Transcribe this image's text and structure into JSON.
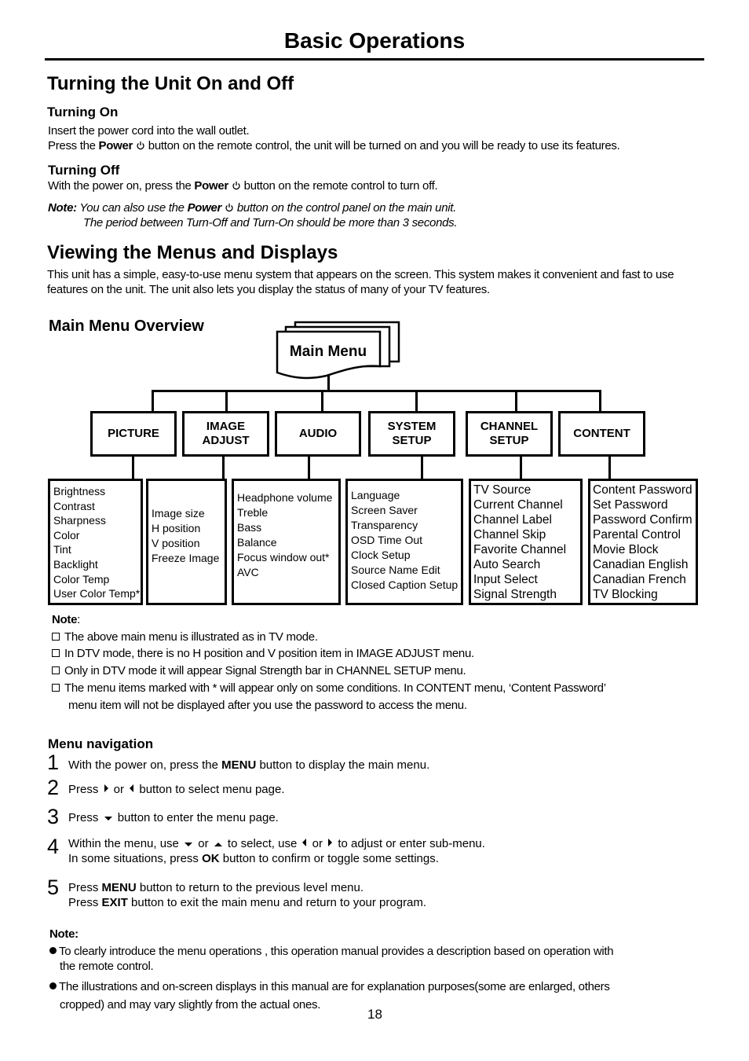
{
  "page": {
    "title": "Basic Operations",
    "page_number": "18"
  },
  "turning": {
    "heading": "Turning the Unit On and Off",
    "on": {
      "heading": "Turning On",
      "line1": "Insert the power cord into the wall outlet.",
      "line2_pre": "Press the ",
      "line2_bold": "Power",
      "line2_post": " button on the remote control, the unit will be turned on and you will be ready to use its features."
    },
    "off": {
      "heading": "Turning Off",
      "line_pre": "With the power on, press the ",
      "line_bold": "Power",
      "line_post": " button on the remote control to turn off."
    },
    "note": {
      "label": "Note:",
      "line1_pre": " You can also use the ",
      "line1_bold": "Power",
      "line1_post": " button on the control panel on the main unit.",
      "line2": "The period between Turn-Off and Turn-On should be more than 3 seconds."
    }
  },
  "menus": {
    "heading": "Viewing the Menus and Displays",
    "intro": "This unit has a simple, easy-to-use menu system that appears on the screen. This system makes it convenient and fast to use features on the unit. The unit also lets you display the status of many of your TV features.",
    "overview_heading": "Main Menu Overview",
    "main_menu_label": "Main Menu",
    "categories": [
      {
        "label": "PICTURE",
        "items": [
          "Brightness",
          "Contrast",
          "Sharpness",
          "Color",
          "Tint",
          "Backlight",
          "Color Temp",
          "User Color Temp*"
        ]
      },
      {
        "label": "IMAGE ADJUST",
        "items": [
          "Image size",
          "H position",
          "V position",
          "Freeze Image"
        ]
      },
      {
        "label": "AUDIO",
        "items": [
          "Headphone volume",
          "Treble",
          "Bass",
          "Balance",
          "Focus window out*",
          "AVC"
        ]
      },
      {
        "label": "SYSTEM SETUP",
        "items": [
          "Language",
          "Screen Saver",
          "Transparency",
          "OSD Time Out",
          "Clock Setup",
          "Source Name Edit",
          "Closed Caption Setup"
        ]
      },
      {
        "label": "CHANNEL SETUP",
        "items": [
          "TV Source",
          "Current Channel",
          "Channel Label",
          "Channel Skip",
          "Favorite Channel",
          "Auto Search",
          "Input Select",
          "Signal Strength"
        ]
      },
      {
        "label": "CONTENT",
        "items": [
          "Content Password",
          "Set Password",
          "Password Confirm",
          "Parental Control",
          "Movie Block",
          "Canadian English",
          "Canadian French",
          "TV Blocking"
        ]
      }
    ]
  },
  "menu_notes": {
    "label": "Note",
    "items": [
      "The above main menu is illustrated as in TV mode.",
      "In DTV mode, there is no H position and V position item in IMAGE ADJUST menu.",
      "Only in DTV mode it will appear Signal Strength bar in CHANNEL SETUP menu.",
      "The menu items marked with * will appear only on some conditions. In CONTENT menu, ‘Content Password’",
      "menu item will not be displayed after you use the password to access the menu."
    ]
  },
  "navigation": {
    "heading": "Menu navigation",
    "steps": [
      {
        "num": "1",
        "pre": "With the power on, press the ",
        "bold": "MENU",
        "post": " button to display the main menu."
      },
      {
        "num": "2",
        "pre": "Press ",
        "mid": " or ",
        "post": " button to select menu page."
      },
      {
        "num": "3",
        "pre": "Press ",
        "post": " button to enter the menu page."
      },
      {
        "num": "4",
        "pre": "Within the menu, use ",
        "or1": " or ",
        "mid": " to select, use ",
        "or2": " or ",
        "post": " to adjust or enter sub-menu.",
        "line2_pre": "In some situations, press ",
        "line2_bold": "OK",
        "line2_post": " button to confirm or toggle some settings."
      },
      {
        "num": "5",
        "pre": "Press ",
        "bold": "MENU",
        "post": " button to return to the previous level menu.",
        "line2_pre": "Press ",
        "line2_bold": "EXIT",
        "line2_post": " button to exit the main menu and return to your program."
      }
    ]
  },
  "final_note": {
    "label": "Note:",
    "bullets": [
      {
        "line1": "To clearly introduce the menu operations , this operation manual provides a description based on operation with",
        "line2": "the remote control."
      },
      {
        "line1": "The illustrations and on-screen displays in this manual are for explanation purposes(some are enlarged, others",
        "line2": "cropped) and may vary slightly from the actual ones."
      }
    ]
  }
}
